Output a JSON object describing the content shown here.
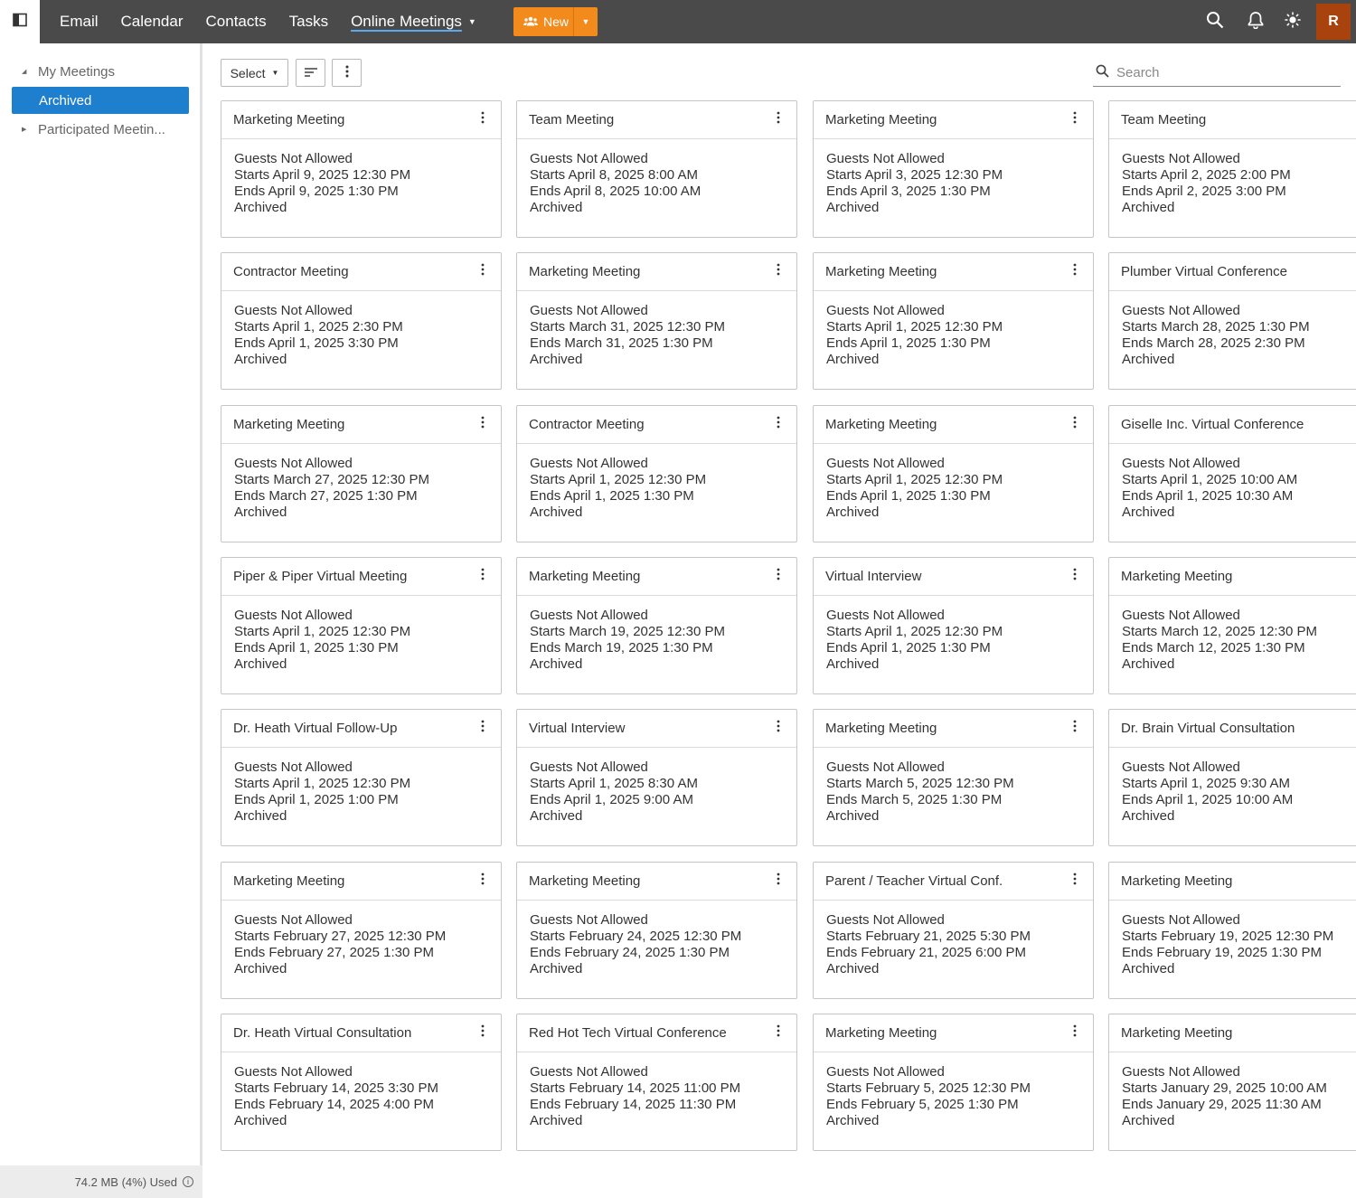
{
  "nav": {
    "items": [
      {
        "label": "Email"
      },
      {
        "label": "Calendar"
      },
      {
        "label": "Contacts"
      },
      {
        "label": "Tasks"
      },
      {
        "label": "Online Meetings"
      }
    ],
    "new_label": "New",
    "avatar_initial": "R"
  },
  "sidebar": {
    "my_meetings": "My Meetings",
    "archived": "Archived",
    "participated": "Participated Meetin...",
    "storage": "74.2 MB (4%) Used"
  },
  "toolbar": {
    "select_label": "Select",
    "search_placeholder": "Search"
  },
  "colors": {
    "topbar": "#4a4a4a",
    "accent_orange": "#f28b1c",
    "selected_blue": "#1f7fcf",
    "avatar": "#a8430e"
  },
  "meetings": [
    {
      "title": "Marketing Meeting",
      "guests": "Guests Not Allowed",
      "starts": "Starts April 9, 2025 12:30 PM",
      "ends": "Ends April 9, 2025 1:30 PM",
      "status": "Archived"
    },
    {
      "title": "Team Meeting",
      "guests": "Guests Not Allowed",
      "starts": "Starts April 8, 2025 8:00 AM",
      "ends": "Ends April 8, 2025 10:00 AM",
      "status": "Archived"
    },
    {
      "title": "Marketing Meeting",
      "guests": "Guests Not Allowed",
      "starts": "Starts April 3, 2025 12:30 PM",
      "ends": "Ends April 3, 2025 1:30 PM",
      "status": "Archived"
    },
    {
      "title": "Team Meeting",
      "guests": "Guests Not Allowed",
      "starts": "Starts April 2, 2025 2:00 PM",
      "ends": "Ends April 2, 2025 3:00 PM",
      "status": "Archived"
    },
    {
      "title": "Contractor Meeting",
      "guests": "Guests Not Allowed",
      "starts": "Starts April 1, 2025 2:30 PM",
      "ends": "Ends April 1, 2025 3:30 PM",
      "status": "Archived"
    },
    {
      "title": "Marketing Meeting",
      "guests": "Guests Not Allowed",
      "starts": "Starts March 31, 2025 12:30 PM",
      "ends": "Ends March 31, 2025 1:30 PM",
      "status": "Archived"
    },
    {
      "title": "Marketing Meeting",
      "guests": "Guests Not Allowed",
      "starts": "Starts April 1, 2025 12:30 PM",
      "ends": "Ends April 1, 2025 1:30 PM",
      "status": "Archived"
    },
    {
      "title": "Plumber Virtual Conference",
      "guests": "Guests Not Allowed",
      "starts": "Starts March 28, 2025 1:30 PM",
      "ends": "Ends March 28, 2025 2:30 PM",
      "status": "Archived"
    },
    {
      "title": "Marketing Meeting",
      "guests": "Guests Not Allowed",
      "starts": "Starts March 27, 2025 12:30 PM",
      "ends": "Ends March 27, 2025 1:30 PM",
      "status": "Archived"
    },
    {
      "title": "Contractor Meeting",
      "guests": "Guests Not Allowed",
      "starts": "Starts April 1, 2025 12:30 PM",
      "ends": "Ends April 1, 2025 1:30 PM",
      "status": "Archived"
    },
    {
      "title": "Marketing Meeting",
      "guests": "Guests Not Allowed",
      "starts": "Starts April 1, 2025 12:30 PM",
      "ends": "Ends April 1, 2025 1:30 PM",
      "status": "Archived"
    },
    {
      "title": "Giselle Inc. Virtual Conference",
      "guests": "Guests Not Allowed",
      "starts": "Starts April 1, 2025 10:00 AM",
      "ends": "Ends April 1, 2025 10:30 AM",
      "status": "Archived"
    },
    {
      "title": "Piper & Piper Virtual Meeting",
      "guests": "Guests Not Allowed",
      "starts": "Starts April 1, 2025 12:30 PM",
      "ends": "Ends April 1, 2025 1:30 PM",
      "status": "Archived"
    },
    {
      "title": "Marketing Meeting",
      "guests": "Guests Not Allowed",
      "starts": "Starts March 19, 2025 12:30 PM",
      "ends": "Ends March 19, 2025 1:30 PM",
      "status": "Archived"
    },
    {
      "title": "Virtual Interview",
      "guests": "Guests Not Allowed",
      "starts": "Starts April 1, 2025 12:30 PM",
      "ends": "Ends April 1, 2025 1:30 PM",
      "status": "Archived"
    },
    {
      "title": "Marketing Meeting",
      "guests": "Guests Not Allowed",
      "starts": "Starts March 12, 2025 12:30 PM",
      "ends": "Ends March 12, 2025 1:30 PM",
      "status": "Archived"
    },
    {
      "title": "Dr. Heath Virtual Follow-Up",
      "guests": "Guests Not Allowed",
      "starts": "Starts April 1, 2025 12:30 PM",
      "ends": "Ends April 1, 2025 1:00 PM",
      "status": "Archived"
    },
    {
      "title": "Virtual Interview",
      "guests": "Guests Not Allowed",
      "starts": "Starts April 1, 2025 8:30 AM",
      "ends": "Ends April 1, 2025 9:00 AM",
      "status": "Archived"
    },
    {
      "title": "Marketing Meeting",
      "guests": "Guests Not Allowed",
      "starts": "Starts March 5, 2025 12:30 PM",
      "ends": "Ends March 5, 2025 1:30 PM",
      "status": "Archived"
    },
    {
      "title": "Dr. Brain Virtual Consultation",
      "guests": "Guests Not Allowed",
      "starts": "Starts April 1, 2025 9:30 AM",
      "ends": "Ends April 1, 2025 10:00 AM",
      "status": "Archived"
    },
    {
      "title": "Marketing Meeting",
      "guests": "Guests Not Allowed",
      "starts": "Starts February 27, 2025 12:30 PM",
      "ends": "Ends February 27, 2025 1:30 PM",
      "status": "Archived"
    },
    {
      "title": "Marketing Meeting",
      "guests": "Guests Not Allowed",
      "starts": "Starts February 24, 2025 12:30 PM",
      "ends": "Ends February 24, 2025 1:30 PM",
      "status": "Archived"
    },
    {
      "title": "Parent / Teacher Virtual Conf.",
      "guests": "Guests Not Allowed",
      "starts": "Starts February 21, 2025 5:30 PM",
      "ends": "Ends February 21, 2025 6:00 PM",
      "status": "Archived"
    },
    {
      "title": "Marketing Meeting",
      "guests": "Guests Not Allowed",
      "starts": "Starts February 19, 2025 12:30 PM",
      "ends": "Ends February 19, 2025 1:30 PM",
      "status": "Archived"
    },
    {
      "title": "Dr. Heath Virtual Consultation",
      "guests": "Guests Not Allowed",
      "starts": "Starts February 14, 2025 3:30 PM",
      "ends": "Ends February 14, 2025 4:00 PM",
      "status": "Archived"
    },
    {
      "title": "Red Hot Tech Virtual Conference",
      "guests": "Guests Not Allowed",
      "starts": "Starts February 14, 2025 11:00 PM",
      "ends": "Ends February 14, 2025 11:30 PM",
      "status": "Archived"
    },
    {
      "title": "Marketing Meeting",
      "guests": "Guests Not Allowed",
      "starts": "Starts February 5, 2025 12:30 PM",
      "ends": "Ends February 5, 2025 1:30 PM",
      "status": "Archived"
    },
    {
      "title": "Marketing Meeting",
      "guests": "Guests Not Allowed",
      "starts": "Starts January 29, 2025 10:00 AM",
      "ends": "Ends January 29, 2025 11:30 AM",
      "status": "Archived"
    }
  ]
}
